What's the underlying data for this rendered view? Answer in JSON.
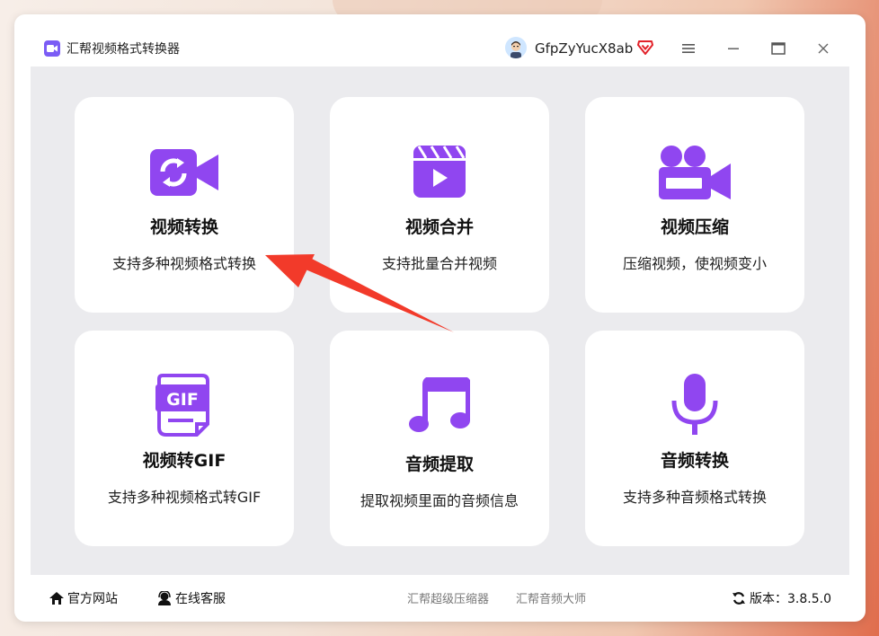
{
  "app": {
    "title": "汇帮视频格式转换器",
    "username": "GfpZyYucX8ab"
  },
  "cards": [
    {
      "title": "视频转换",
      "desc": "支持多种视频格式转换",
      "icon": "video-convert-icon"
    },
    {
      "title": "视频合并",
      "desc": "支持批量合并视频",
      "icon": "video-merge-icon"
    },
    {
      "title": "视频压缩",
      "desc": "压缩视频，使视频变小",
      "icon": "video-compress-icon"
    },
    {
      "title": "视频转GIF",
      "desc": "支持多种视频格式转GIF",
      "icon": "gif-icon"
    },
    {
      "title": "音频提取",
      "desc": "提取视频里面的音频信息",
      "icon": "music-note-icon"
    },
    {
      "title": "音频转换",
      "desc": "支持多种音频格式转换",
      "icon": "microphone-icon"
    }
  ],
  "footer": {
    "official_site": "官方网站",
    "online_service": "在线客服",
    "link1": "汇帮超级压缩器",
    "link2": "汇帮音频大师",
    "version": "版本：3.8.5.0"
  },
  "colors": {
    "accent": "#9046f0",
    "annotation_arrow": "#f23a2a"
  }
}
